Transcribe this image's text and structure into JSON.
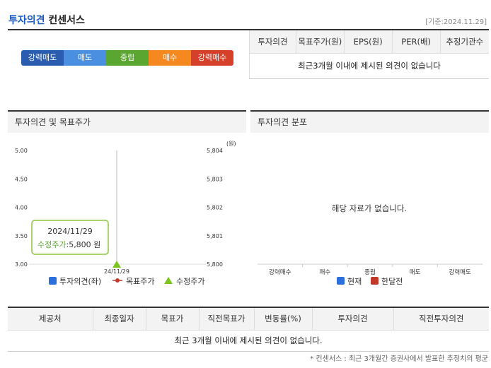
{
  "header": {
    "title_main": "투자의견",
    "title_sub": "컨센서스",
    "date": "[기준:2024.11.29]"
  },
  "opinion_scale": [
    {
      "label": "강력매도",
      "color": "#2a5db0"
    },
    {
      "label": "매도",
      "color": "#4a8fe0"
    },
    {
      "label": "중립",
      "color": "#5ba531"
    },
    {
      "label": "매수",
      "color": "#f5891f"
    },
    {
      "label": "강력매수",
      "color": "#d5402b"
    }
  ],
  "opinion_table": {
    "headers": [
      "투자의견",
      "목표주가(원)",
      "EPS(원)",
      "PER(배)",
      "추정기관수"
    ],
    "message": "최근3개월 이내에 제시된 의견이 없습니다"
  },
  "left_panel": {
    "title": "투자의견 및 목표주가",
    "unit": "(원)",
    "tooltip_date": "2024/11/29",
    "tooltip_label": "수정주가",
    "tooltip_value": ":5,800 원"
  },
  "right_panel": {
    "title": "투자의견 분포",
    "empty_message": "해당 자료가 없습니다."
  },
  "chart_data": [
    {
      "type": "line",
      "x": [
        "24/11/29"
      ],
      "y_left_ticks": [
        "5.00",
        "4.50",
        "4.00",
        "3.50",
        "3.00"
      ],
      "y_right_ticks": [
        "5,804",
        "5,803",
        "5,802",
        "5,801",
        "5,800"
      ],
      "ylim_left": [
        3.0,
        5.0
      ],
      "ylim_right": [
        5800,
        5804
      ],
      "series": [
        {
          "name": "투자의견(좌)",
          "values": [],
          "color": "#2a6fdb"
        },
        {
          "name": "목표주가",
          "values": [],
          "color": "#c0392b"
        },
        {
          "name": "수정주가",
          "values": [
            5800
          ],
          "color": "#7cc41e"
        }
      ],
      "legend": "bottom"
    },
    {
      "type": "bar",
      "categories": [
        "강력매수",
        "매수",
        "중립",
        "매도",
        "강력매도"
      ],
      "series": [
        {
          "name": "현재",
          "values": [],
          "color": "#2a6fdb"
        },
        {
          "name": "한달전",
          "values": [],
          "color": "#c0392b"
        }
      ],
      "legend": "bottom"
    }
  ],
  "bottom_table": {
    "headers": [
      "제공처",
      "최종일자",
      "목표가",
      "직전목표가",
      "변동률(%)",
      "투자의견",
      "직전투자의견"
    ],
    "message": "최근 3개월 이내에 제시된 의견이 없습니다."
  },
  "footnote": "* 컨센서스 : 최근 3개월간 증권사에서 발표한 추정치의 평균"
}
